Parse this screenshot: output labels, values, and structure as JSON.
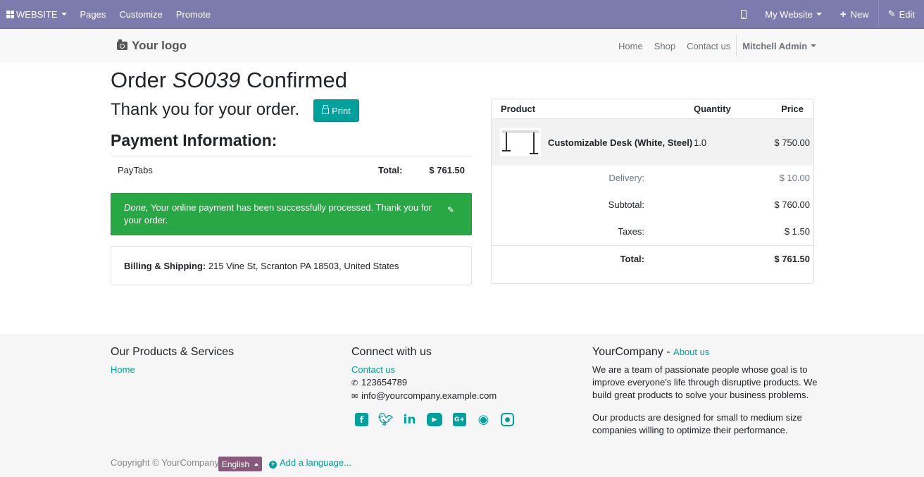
{
  "adminbar": {
    "website_label": "WEBSITE",
    "pages_label": "Pages",
    "customize_label": "Customize",
    "promote_label": "Promote",
    "my_website_label": "My Website",
    "new_label": "New",
    "edit_label": "Edit",
    "color": "#7c7bad"
  },
  "header": {
    "logo_text": "Your logo",
    "nav": [
      "Home",
      "Shop",
      "Contact us"
    ],
    "user": "Mitchell Admin"
  },
  "order": {
    "title_prefix": "Order ",
    "order_number": "SO039",
    "title_suffix": " Confirmed",
    "thanks": "Thank you for your order.",
    "print_label": "Print",
    "payment_heading": "Payment Information:",
    "payment_method": "PayTabs",
    "total_label": "Total:",
    "total_value": "$ 761.50",
    "alert_done": "Done,",
    "alert_message": " Your online payment has been successfully processed. Thank you for your order.",
    "billing_label": "Billing & Shipping:",
    "billing_address": " 215 Vine St, Scranton PA 18503, United States"
  },
  "summary": {
    "col_product": "Product",
    "col_quantity": "Quantity",
    "col_price": "Price",
    "product_name": "Customizable Desk (White, Steel)",
    "product_qty": "1.0",
    "product_price": "$ 750.00",
    "delivery_label": "Delivery:",
    "delivery_value": "$ 10.00",
    "subtotal_label": "Subtotal:",
    "subtotal_value": "$ 760.00",
    "taxes_label": "Taxes:",
    "taxes_value": "$ 1.50",
    "total_label": "Total:",
    "total_value": "$ 761.50"
  },
  "footer": {
    "col1_title": "Our Products & Services",
    "col1_link": "Home",
    "col2_title": "Connect with us",
    "col2_contact": "Contact us",
    "phone": "123654789",
    "email": "info@yourcompany.example.com",
    "col3_title": "YourCompany",
    "col3_sep": " - ",
    "col3_about": "About us",
    "col3_p1": "We are a team of passionate people whose goal is to improve everyone's life through disruptive products. We build great products to solve your business problems.",
    "col3_p2": "Our products are designed for small to medium size companies willing to optimize their performance.",
    "social_icons": [
      "facebook-icon",
      "twitter-icon",
      "linkedin-icon",
      "youtube-icon",
      "google-plus-icon",
      "github-icon",
      "instagram-icon"
    ],
    "copyright": "Copyright © YourCompany",
    "language": "English",
    "add_language": "Add a language...",
    "accent_color": "#00a09d",
    "success_color": "#28a745",
    "language_button_color": "#875a7b"
  }
}
